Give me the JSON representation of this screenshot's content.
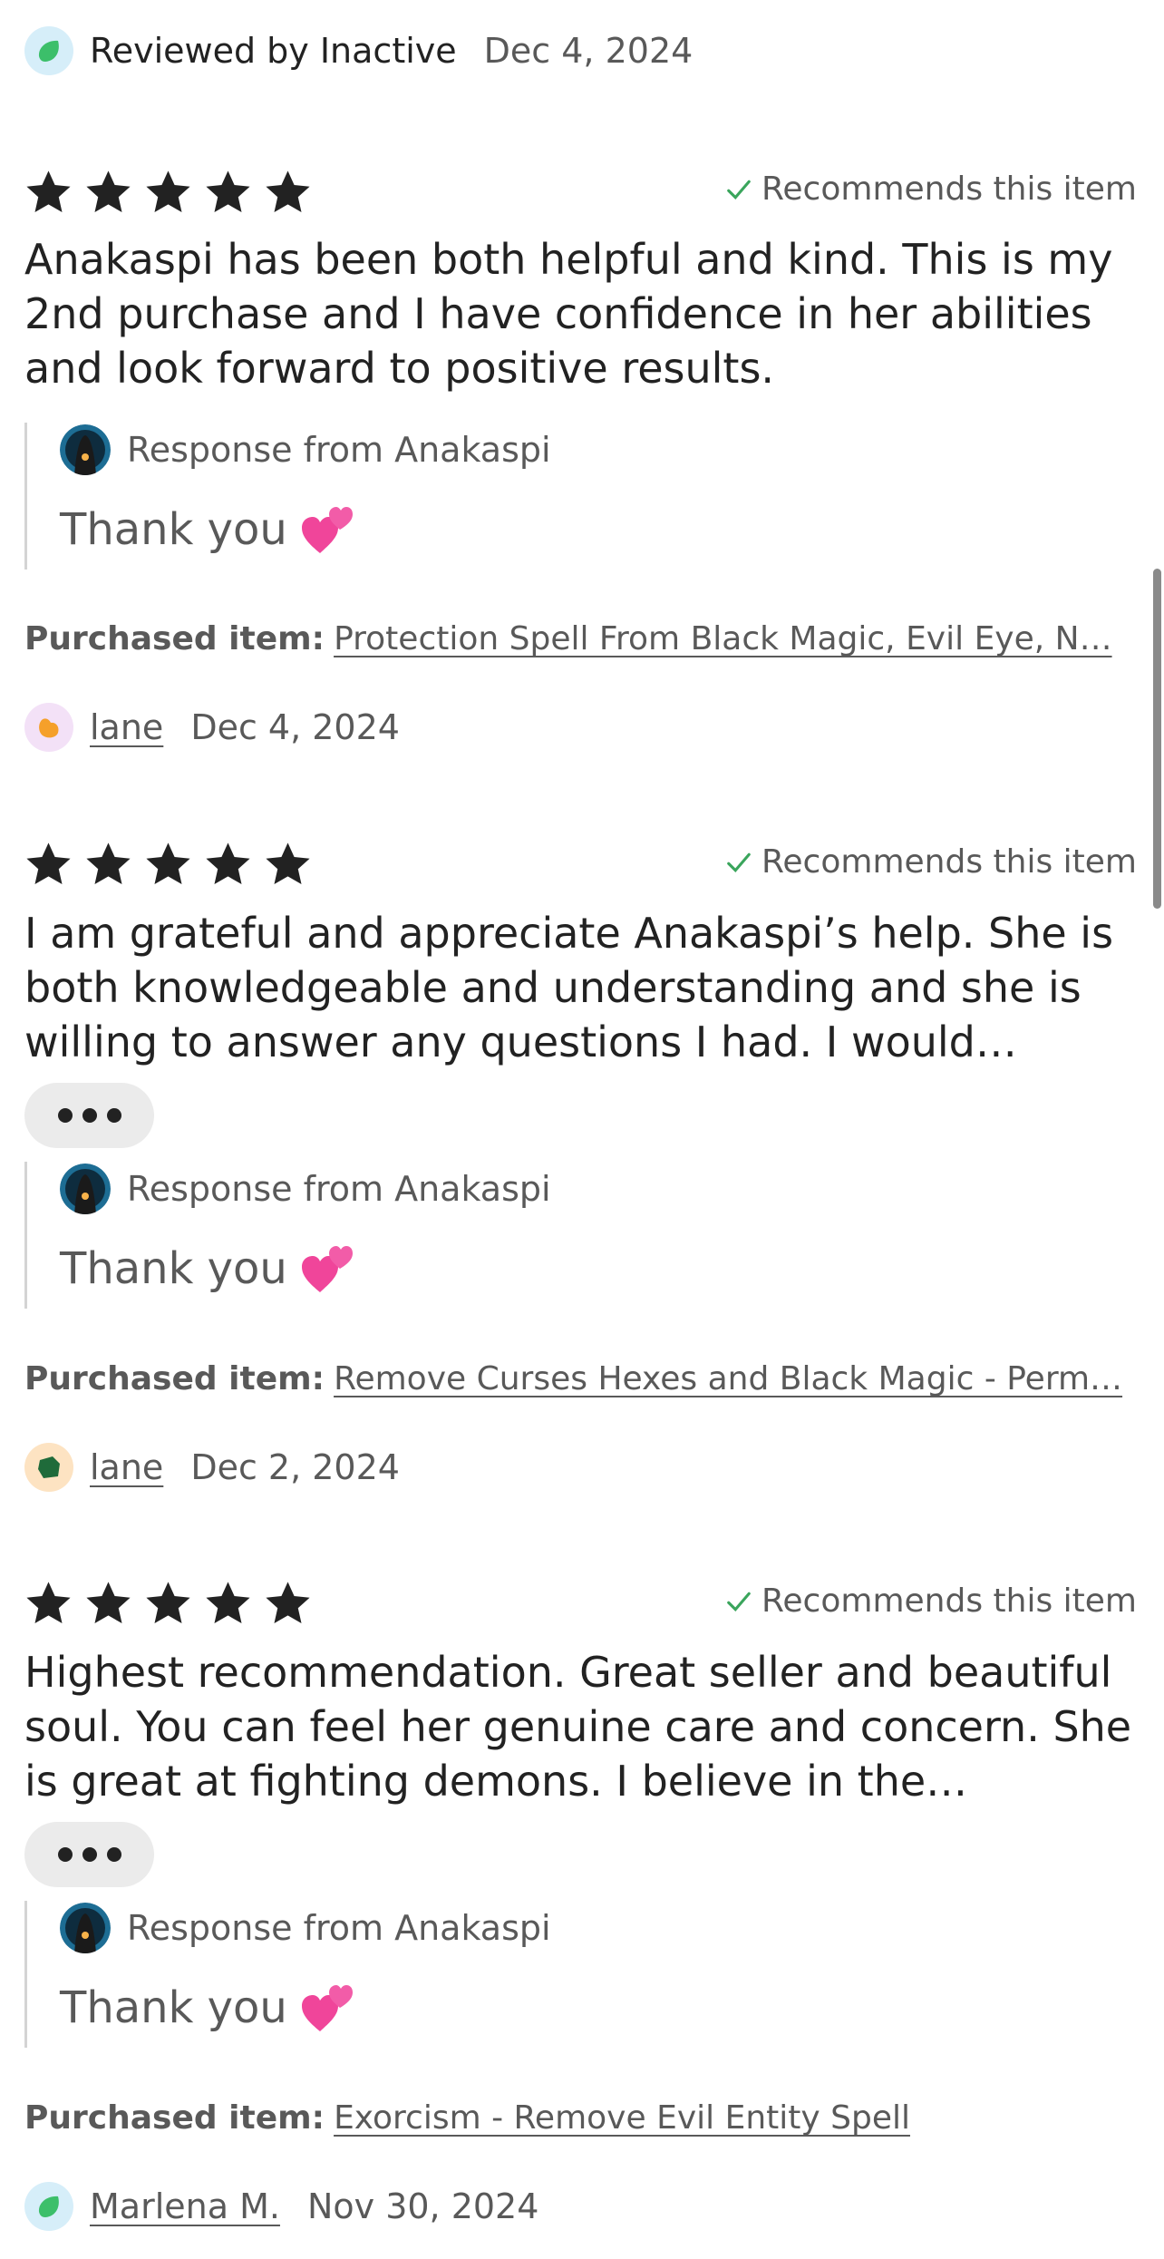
{
  "reviews_top": {
    "reviewer_name": "Reviewed by Inactive",
    "date": "Dec 4, 2024"
  },
  "reviews": [
    {
      "recommend_label": "Recommends this item",
      "text": "Anakaspi has been both helpful and kind. This is my 2nd purchase and I have confidence in her abilities and look forward to positive results.",
      "response_from": "Response from Anakaspi",
      "response_text": "Thank you",
      "purchased_label": "Purchased item:",
      "purchased_item": "Protection Spell From Black Magic, Evil Eye, N…",
      "reviewer_name": "lane",
      "date": "Dec 4, 2024",
      "reviewer_avatar_color": "#f5a02a"
    },
    {
      "recommend_label": "Recommends this item",
      "text": "I am grateful and appreciate Anakaspi’s help. She is both knowledgeable and understanding and she is willing to answer any questions I had. I would…",
      "more_label": "•••",
      "response_from": "Response from Anakaspi",
      "response_text": "Thank you",
      "purchased_label": "Purchased item:",
      "purchased_item": "Remove Curses Hexes and Black Magic - Perm…",
      "reviewer_name": "lane",
      "date": "Dec 2, 2024",
      "reviewer_avatar_color": "#1f6b3a"
    },
    {
      "recommend_label": "Recommends this item",
      "text": "Highest recommendation. Great seller and beautiful soul. You can feel her genuine care and concern. She is great at fighting demons. I believe in the…",
      "more_label": "•••",
      "response_from": "Response from Anakaspi",
      "response_text": "Thank you",
      "purchased_label": "Purchased item:",
      "purchased_item": "Exorcism - Remove Evil Entity Spell",
      "reviewer_name": "Marlena M.",
      "date": "Nov 30, 2024",
      "reviewer_avatar_color": "#3cbf6a"
    }
  ],
  "rating_stars": 5,
  "colors": {
    "star": "#222222",
    "check": "#3aa55c",
    "heart": "#f0459a",
    "muted_text": "#595959"
  },
  "icons": {
    "star": "star-icon",
    "check": "check-icon",
    "heart": "two-hearts-emoji",
    "more": "ellipsis-icon"
  }
}
